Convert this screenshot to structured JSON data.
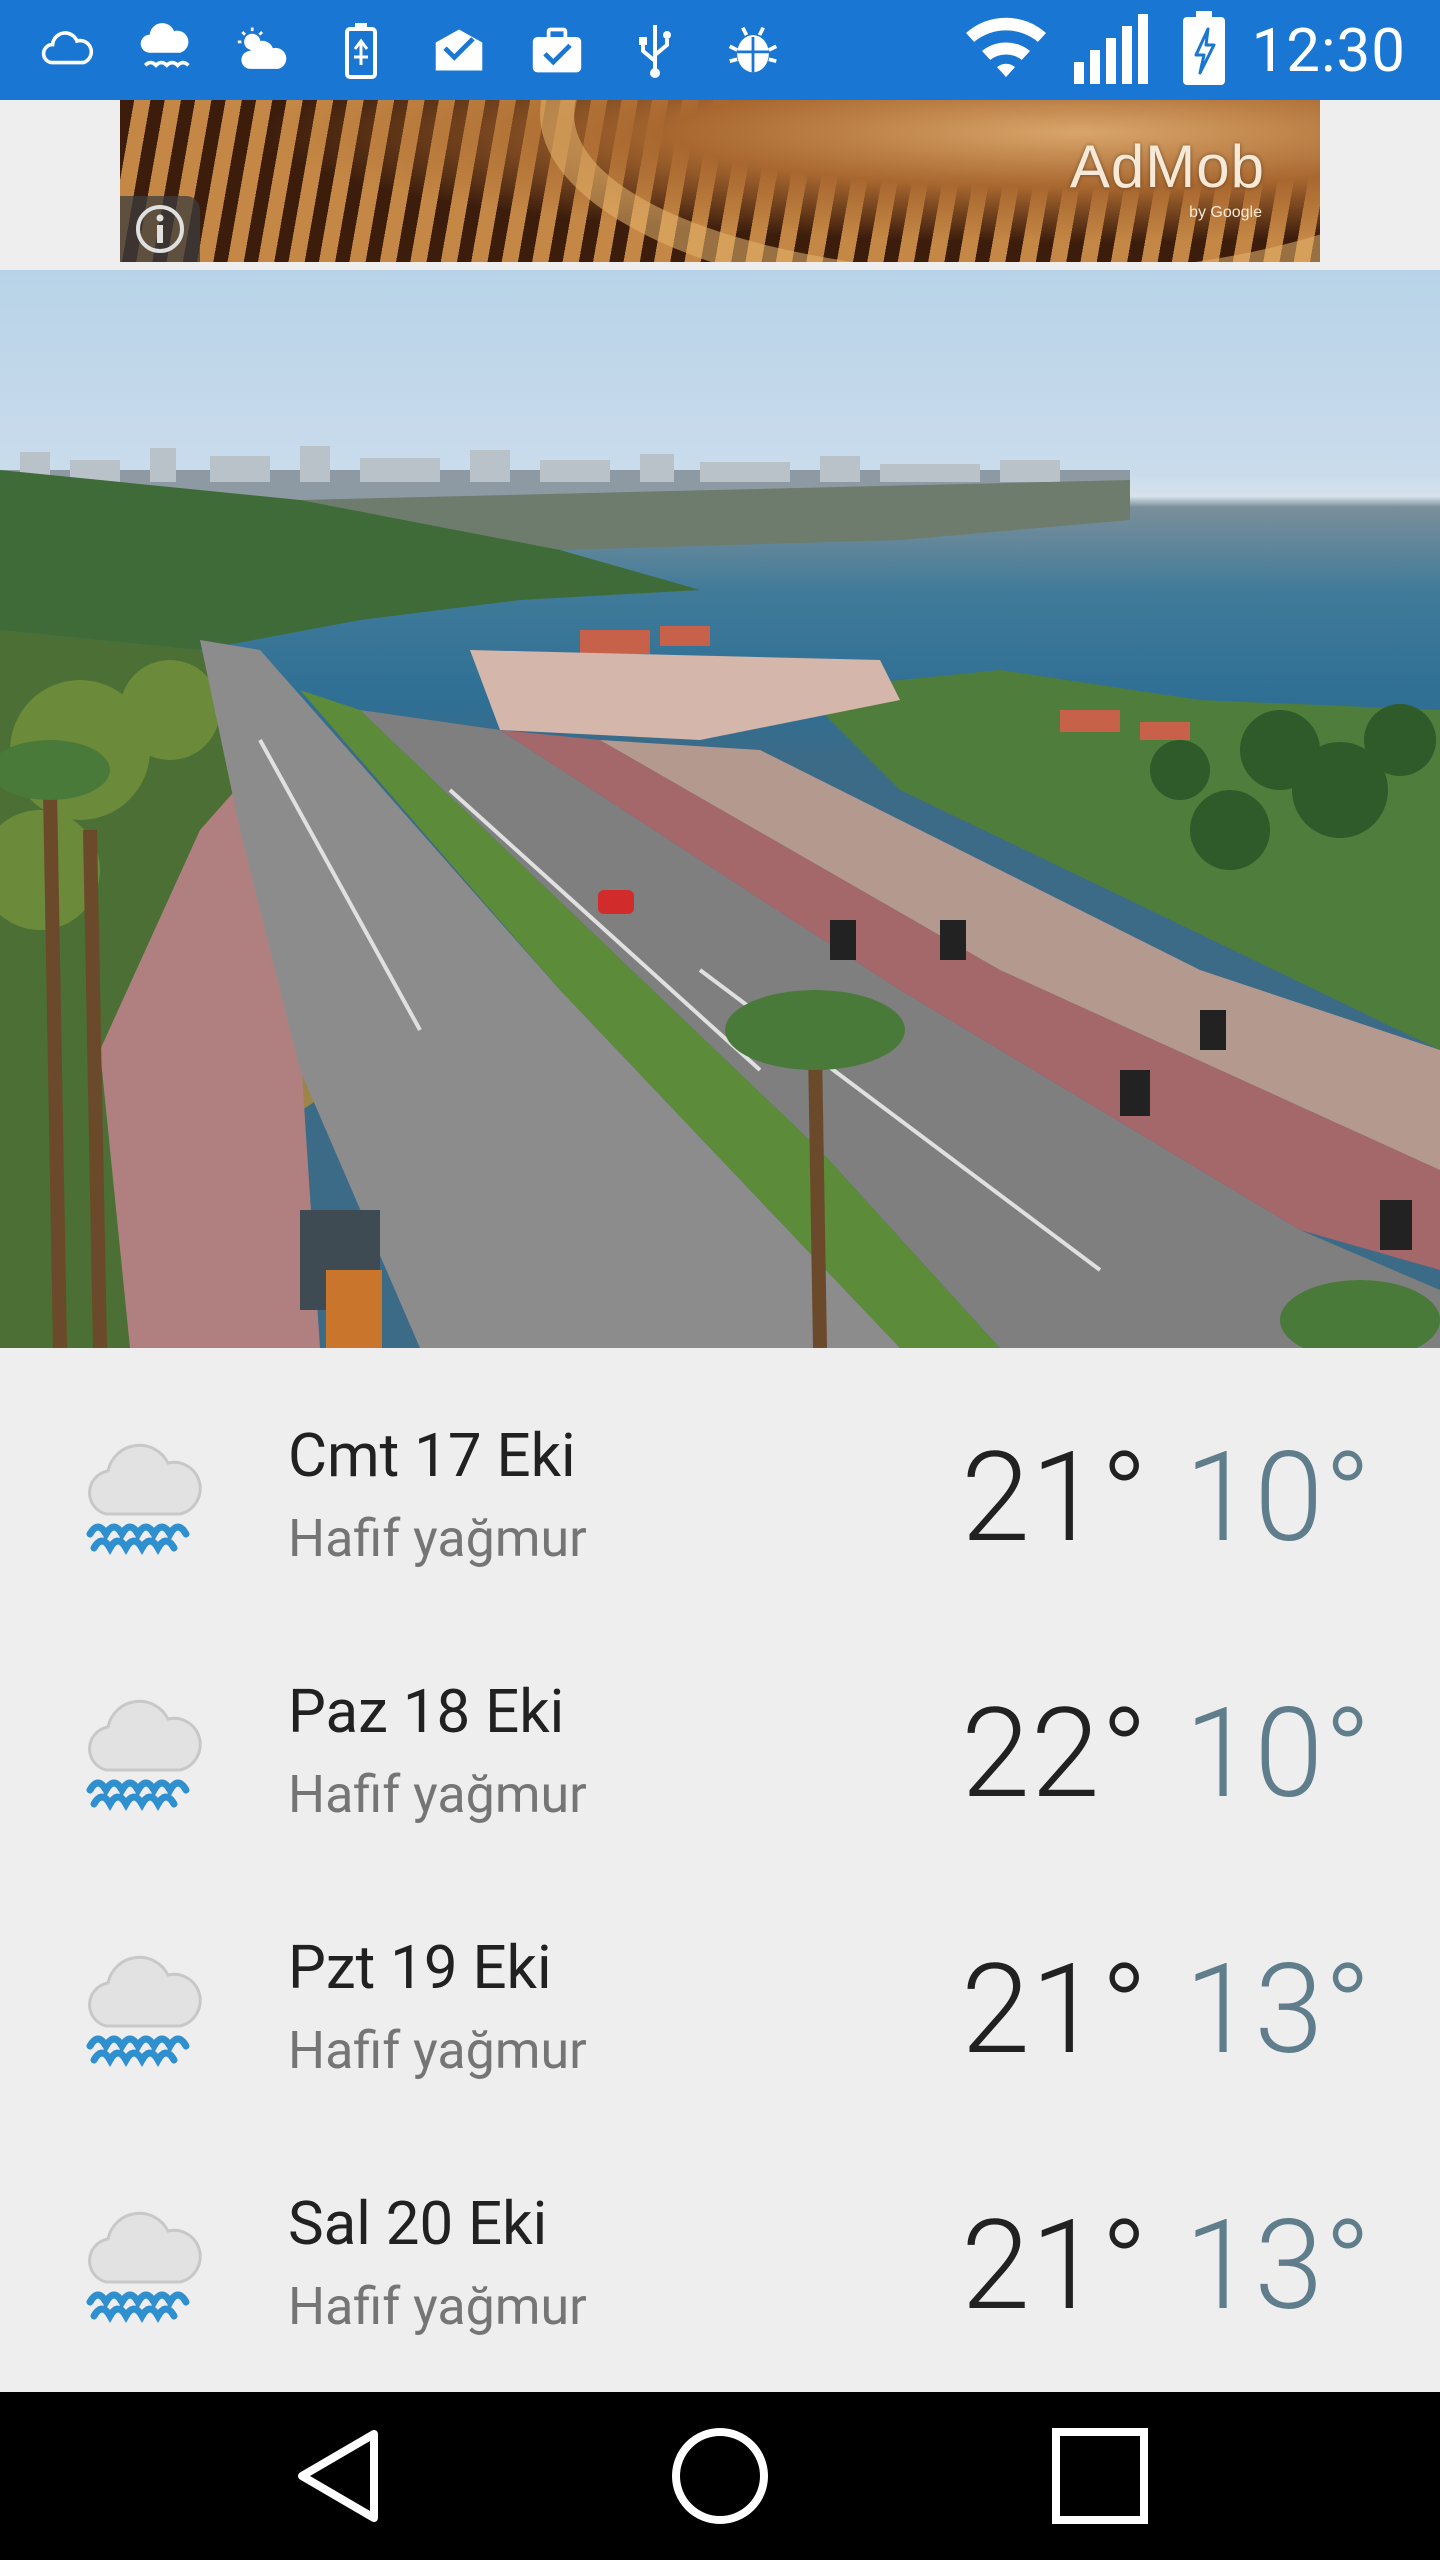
{
  "status_bar": {
    "time": "12:30",
    "notification_icons": [
      "cloud-icon",
      "rain-cloud-icon",
      "sun-cloud-icon",
      "battery-usb-icon",
      "mail-check-icon",
      "briefcase-check-icon",
      "usb-icon",
      "android-debug-icon"
    ],
    "system_icons": [
      "wifi-icon",
      "signal-icon",
      "battery-charging-icon"
    ],
    "color": "#1976d2"
  },
  "ad": {
    "brand": "AdMob",
    "brand_sub": "by Google"
  },
  "forecast": [
    {
      "day": "Cmt 17 Eki",
      "condition": "Hafif yağmur",
      "high": "21°",
      "low": "10°",
      "icon": "light-rain-icon"
    },
    {
      "day": "Paz 18 Eki",
      "condition": "Hafif yağmur",
      "high": "22°",
      "low": "10°",
      "icon": "light-rain-icon"
    },
    {
      "day": "Pzt 19 Eki",
      "condition": "Hafif yağmur",
      "high": "21°",
      "low": "13°",
      "icon": "light-rain-icon"
    },
    {
      "day": "Sal 20 Eki",
      "condition": "Hafif yağmur",
      "high": "21°",
      "low": "13°",
      "icon": "light-rain-icon"
    }
  ],
  "colors": {
    "temp_high": "#212121",
    "temp_low": "#607d8b",
    "background": "#eeeeee"
  }
}
